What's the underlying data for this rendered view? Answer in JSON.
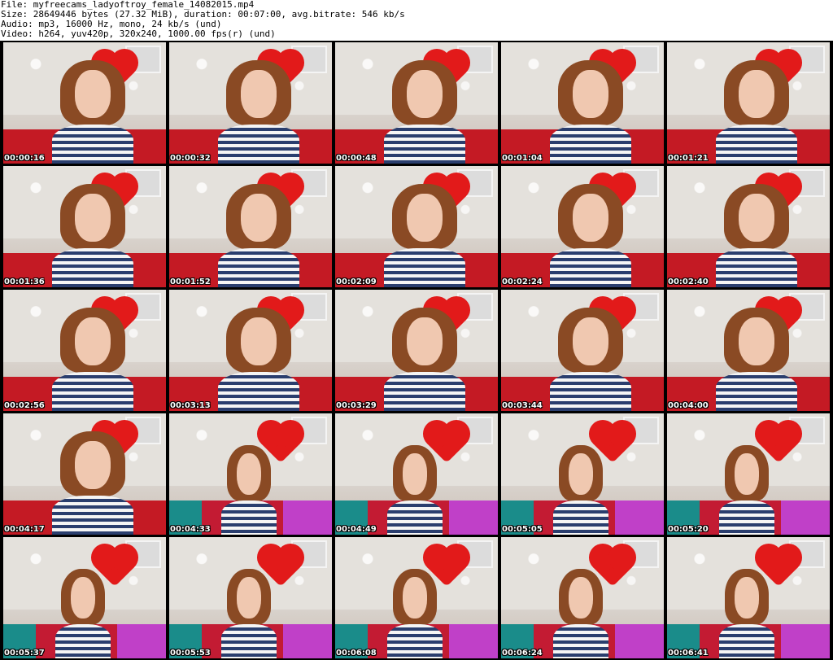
{
  "header": {
    "file_line": "File: myfreecams_ladyoftroy_female_14082015.mp4",
    "size_line": "Size: 28649446 bytes (27.32 MiB), duration: 00:07:00, avg.bitrate: 546 kb/s",
    "audio_line": "Audio: mp3, 16000 Hz, mono, 24 kb/s (und)",
    "video_line": "Video: h264, yuv420p, 320x240, 1000.00 fps(r) (und)"
  },
  "thumbnails": [
    {
      "timestamp": "00:00:16"
    },
    {
      "timestamp": "00:00:32"
    },
    {
      "timestamp": "00:00:48"
    },
    {
      "timestamp": "00:01:04"
    },
    {
      "timestamp": "00:01:21"
    },
    {
      "timestamp": "00:01:36"
    },
    {
      "timestamp": "00:01:52"
    },
    {
      "timestamp": "00:02:09"
    },
    {
      "timestamp": "00:02:24"
    },
    {
      "timestamp": "00:02:40"
    },
    {
      "timestamp": "00:02:56"
    },
    {
      "timestamp": "00:03:13"
    },
    {
      "timestamp": "00:03:29"
    },
    {
      "timestamp": "00:03:44"
    },
    {
      "timestamp": "00:04:00"
    },
    {
      "timestamp": "00:04:17"
    },
    {
      "timestamp": "00:04:33"
    },
    {
      "timestamp": "00:04:49"
    },
    {
      "timestamp": "00:05:05"
    },
    {
      "timestamp": "00:05:20"
    },
    {
      "timestamp": "00:05:37"
    },
    {
      "timestamp": "00:05:53"
    },
    {
      "timestamp": "00:06:08"
    },
    {
      "timestamp": "00:06:24"
    },
    {
      "timestamp": "00:06:41"
    }
  ]
}
